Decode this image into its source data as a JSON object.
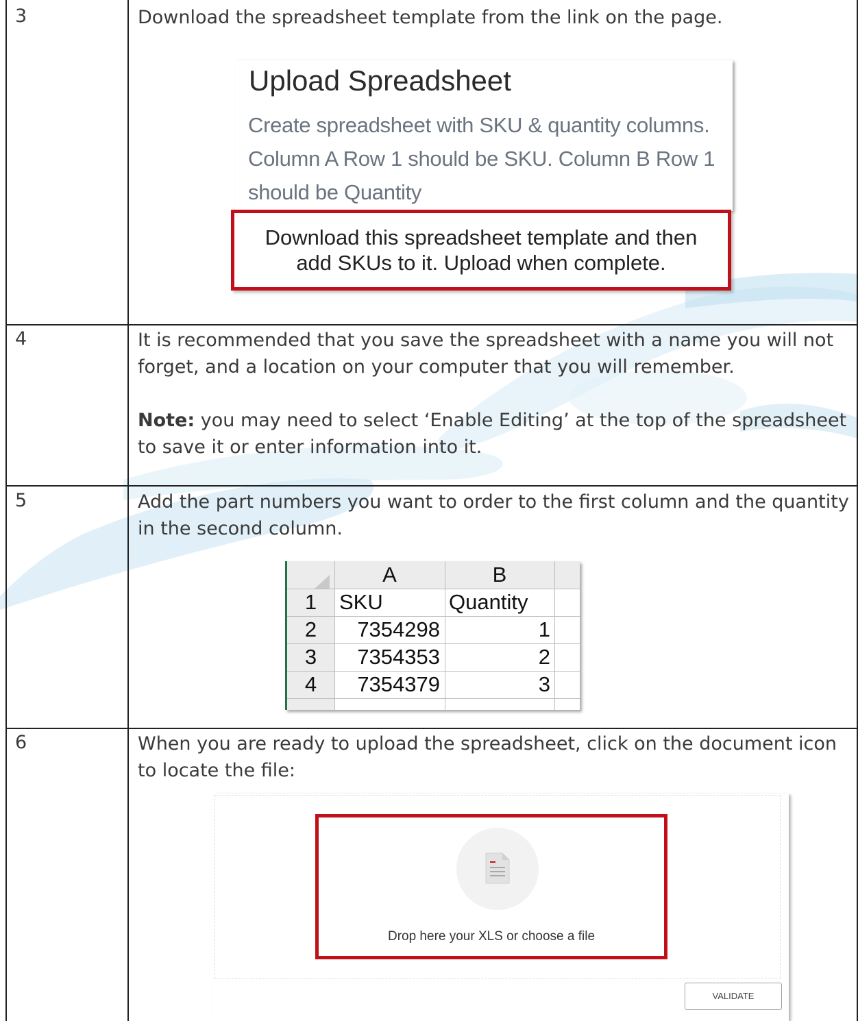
{
  "rows": [
    {
      "number": "3",
      "text": "Download the spreadsheet template from the link on the page."
    },
    {
      "number": "4",
      "text": "It is recommended that you save the spreadsheet with a name you will not forget, and a location on your computer that you will remember.",
      "note_label": "Note:",
      "note_text": " you may need to select ‘Enable Editing’ at the top of the spreadsheet to save it or enter information into it."
    },
    {
      "number": "5",
      "text": "Add the part numbers you want to order to the first column and the quantity in the second column."
    },
    {
      "number": "6",
      "text": "When you are ready to upload the spreadsheet, click on the document icon to locate the file:"
    }
  ],
  "upload_panel": {
    "title": "Upload Spreadsheet",
    "description": "Create spreadsheet with SKU & quantity columns. Column A Row 1 should be SKU. Column B Row 1 should be Quantity",
    "download_line1": "Download this spreadsheet template and then",
    "download_line2": "add SKUs to it. Upload when complete."
  },
  "spreadsheet": {
    "columns": [
      "A",
      "B"
    ],
    "rows": [
      {
        "row": "1",
        "a": "SKU",
        "b": "Quantity"
      },
      {
        "row": "2",
        "a": "7354298",
        "b": "1"
      },
      {
        "row": "3",
        "a": "7354353",
        "b": "2"
      },
      {
        "row": "4",
        "a": "7354379",
        "b": "3"
      }
    ]
  },
  "drop_zone": {
    "icon": "document-icon",
    "label": "Drop here your XLS or choose a file",
    "validate_label": "VALIDATE"
  },
  "colors": {
    "highlight": "#c0111a",
    "excel_green": "#217346"
  }
}
